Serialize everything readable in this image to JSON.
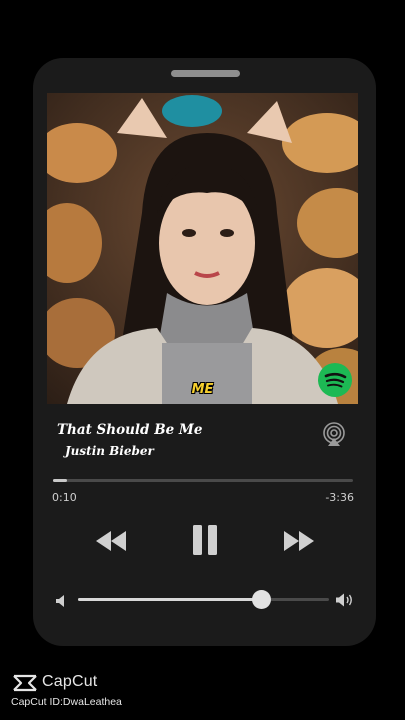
{
  "track": {
    "title": "That Should Be Me",
    "artist": "Justin Bieber",
    "lyric_caption": "ME"
  },
  "progress": {
    "elapsed": "0:10",
    "remaining": "-3:36",
    "fraction": 0.045
  },
  "volume": {
    "level": 0.73
  },
  "controls": {
    "rewind_icon": "rewind-icon",
    "pause_icon": "pause-icon",
    "forward_icon": "fast-forward-icon",
    "airplay_icon": "airplay-icon",
    "volume_low_icon": "volume-low-icon",
    "volume_high_icon": "volume-high-icon"
  },
  "badge": {
    "icon": "spotify-icon",
    "color": "#1db954"
  },
  "watermark": {
    "app_name": "CapCut",
    "id_text": "CapCut ID:DwaLeathea"
  },
  "colors": {
    "background": "#000000",
    "player": "#1b1b1b",
    "caption": "#f6cf2d"
  }
}
